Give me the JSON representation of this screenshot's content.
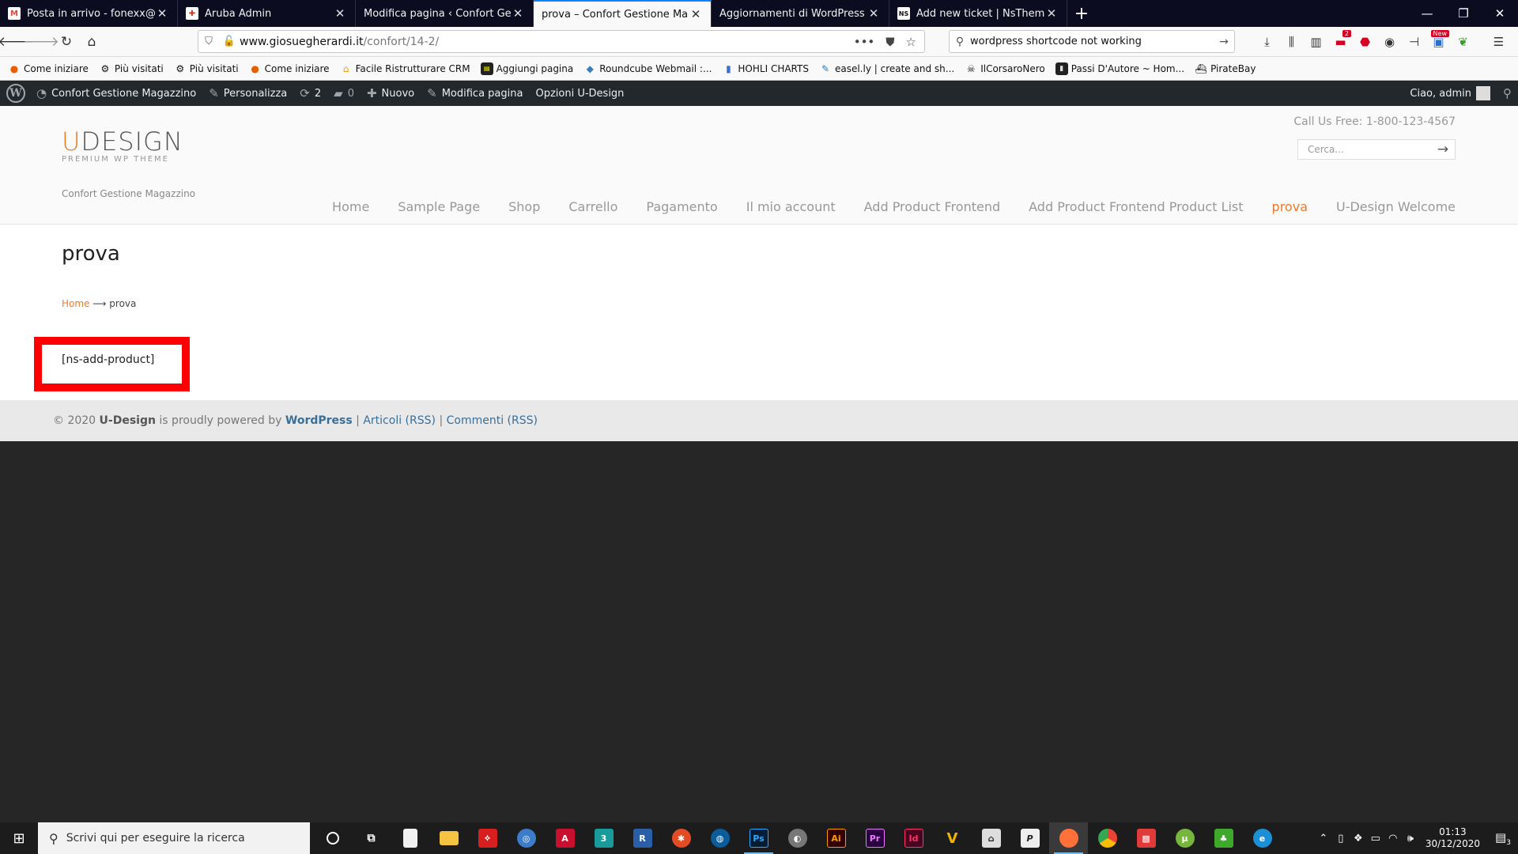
{
  "browser": {
    "tabs": [
      {
        "title": "Posta in arrivo - fonexx@gmail",
        "icon": "gmail-icon",
        "active": false
      },
      {
        "title": "Aruba Admin",
        "icon": "aruba-icon",
        "active": false
      },
      {
        "title": "Modifica pagina ‹ Confort Gestione",
        "icon": "wordpress-icon",
        "active": false
      },
      {
        "title": "prova – Confort Gestione Magazzin",
        "icon": "site-icon",
        "active": true
      },
      {
        "title": "Aggiornamenti di WordPress ‹ Conf",
        "icon": "wordpress-icon",
        "active": false
      },
      {
        "title": "Add new ticket | NsThemes",
        "icon": "nsthemes-icon",
        "active": false
      }
    ],
    "url_domain": "www.giosueghe­rardi.it",
    "url_domain_clean": "www.giosuegherardi.it",
    "url_path": "/confort/14-2/",
    "search_value": "wordpress shortcode not working",
    "toolbar_badge": "2",
    "new_badge": "New"
  },
  "bookmarks": [
    {
      "label": "Come iniziare",
      "icon": "firefox-icon",
      "color": "#e66000"
    },
    {
      "label": "Più visitati",
      "icon": "gear-icon",
      "color": "#444"
    },
    {
      "label": "Più visitati",
      "icon": "gear-icon",
      "color": "#444"
    },
    {
      "label": "Come iniziare",
      "icon": "firefox-icon",
      "color": "#e66000"
    },
    {
      "label": "Facile Ristrutturare CRM",
      "icon": "house-icon",
      "color": "#f0a000"
    },
    {
      "label": "Aggiungi pagina",
      "icon": "page-icon",
      "color": "#222"
    },
    {
      "label": "Roundcube Webmail :...",
      "icon": "roundcube-icon",
      "color": "#3a7fc0"
    },
    {
      "label": "HOHLI CHARTS",
      "icon": "chart-icon",
      "color": "#3a6fd0"
    },
    {
      "label": "easel.ly | create and sh...",
      "icon": "pencil-icon",
      "color": "#2a7ab0"
    },
    {
      "label": "IlCorsaroNero",
      "icon": "pirate-icon",
      "color": "#333"
    },
    {
      "label": "Passi D'Autore ~ Hom...",
      "icon": "book-icon",
      "color": "#222"
    },
    {
      "label": "PirateBay",
      "icon": "ship-icon",
      "color": "#333"
    }
  ],
  "wp_admin_bar": {
    "site_name": "Confort Gestione Magazzino",
    "customize": "Personalizza",
    "updates_count": "2",
    "comments_count": "0",
    "new_label": "Nuovo",
    "edit_page": "Modifica pagina",
    "theme_options": "Opzioni U-Design",
    "greeting": "Ciao, admin"
  },
  "site": {
    "logo_main_u": "U",
    "logo_main_rest": "DESIGN",
    "logo_sub": "PREMIUM WP THEME",
    "tagline": "Confort Gestione Magazzino",
    "call_us": "Call Us Free: 1-800-123-4567",
    "search_placeholder": "Cerca...",
    "nav": [
      {
        "label": "Home",
        "active": false
      },
      {
        "label": "Sample Page",
        "active": false
      },
      {
        "label": "Shop",
        "active": false
      },
      {
        "label": "Carrello",
        "active": false
      },
      {
        "label": "Pagamento",
        "active": false
      },
      {
        "label": "Il mio account",
        "active": false
      },
      {
        "label": "Add Product Frontend",
        "active": false
      },
      {
        "label": "Add Product Frontend Product List",
        "active": false
      },
      {
        "label": "prova",
        "active": true
      },
      {
        "label": "U-Design Welcome",
        "active": false
      }
    ],
    "page_title": "prova",
    "breadcrumb_home": "Home",
    "breadcrumb_sep": "⟶",
    "breadcrumb_current": "prova",
    "shortcode_text": "[ns-add-product]",
    "footer": {
      "copy": "© 2020",
      "brand": "U-Design",
      "powered": "is proudly powered by",
      "wordpress": "WordPress",
      "sep1": "|",
      "articles": "Articoli (RSS)",
      "sep2": "|",
      "comments": "Commenti (RSS)"
    }
  },
  "taskbar": {
    "search_placeholder": "Scrivi qui per eseguire la ricerca",
    "apps": [
      {
        "icon": "cortana-icon",
        "label": "",
        "color": "#1c1c1c"
      },
      {
        "icon": "task-view-icon",
        "label": "",
        "color": "#1c1c1c"
      },
      {
        "icon": "file-icon",
        "label": "",
        "color": "#f0f0f0"
      },
      {
        "icon": "folder-icon",
        "label": "",
        "color": "#f5c242"
      },
      {
        "icon": "acrobat-icon",
        "label": "",
        "color": "#d71f1f"
      },
      {
        "icon": "vpn-icon",
        "label": "",
        "color": "#3c7cc8"
      },
      {
        "icon": "autocad-icon",
        "label": "A",
        "color": "#c8102e"
      },
      {
        "icon": "app-3-icon",
        "label": "3",
        "color": "#1a9b9b"
      },
      {
        "icon": "revit-icon",
        "label": "R",
        "color": "#2a5fa8"
      },
      {
        "icon": "gear-app-icon",
        "label": "",
        "color": "#e24c25"
      },
      {
        "icon": "sketchup-icon",
        "label": "",
        "color": "#0a5c9a"
      },
      {
        "icon": "photoshop-icon",
        "label": "Ps",
        "color": "#001e36"
      },
      {
        "icon": "globe-icon",
        "label": "",
        "color": "#777"
      },
      {
        "icon": "illustrator-icon",
        "label": "Ai",
        "color": "#330000"
      },
      {
        "icon": "premiere-icon",
        "label": "Pr",
        "color": "#2a003f"
      },
      {
        "icon": "indesign-icon",
        "label": "Id",
        "color": "#49021f"
      },
      {
        "icon": "vectorworks-icon",
        "label": "V",
        "color": "#f0b400"
      },
      {
        "icon": "pdf-viewer-icon",
        "label": "",
        "color": "#ddd"
      },
      {
        "icon": "p-app-icon",
        "label": "P",
        "color": "#eee"
      },
      {
        "icon": "firefox-icon",
        "label": "",
        "color": "#ff7139"
      },
      {
        "icon": "chrome-icon",
        "label": "",
        "color": "#4285f4"
      },
      {
        "icon": "toolbox-icon",
        "label": "",
        "color": "#e03b3b"
      },
      {
        "icon": "utorrent-icon",
        "label": "",
        "color": "#77b63d"
      },
      {
        "icon": "game-icon",
        "label": "",
        "color": "#3ea82a"
      },
      {
        "icon": "edge-icon",
        "label": "",
        "color": "#1d8fd6"
      }
    ],
    "time": "01:13",
    "date": "30/12/2020",
    "notifications": "3"
  },
  "colors": {
    "accent": "#e97c2d",
    "wp_bar": "#23282d",
    "highlight_box": "#ff0000",
    "footer_link": "#3a6f98"
  }
}
